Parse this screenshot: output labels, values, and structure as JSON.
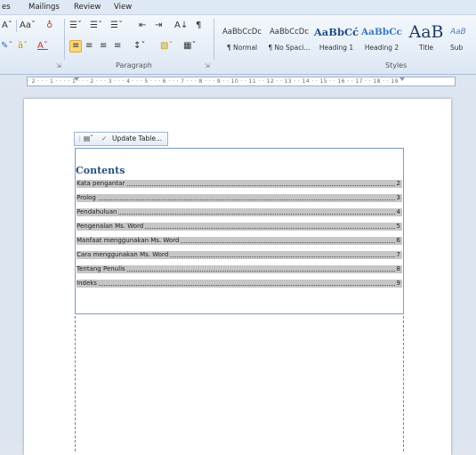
{
  "menu": {
    "tabs": [
      "es",
      "Mailings",
      "Review",
      "View"
    ]
  },
  "ribbon": {
    "font_row1": [
      "Aˆ",
      "Aaˇ",
      "♁"
    ],
    "font_row2": [
      "✎ˇ",
      "āˇ",
      "Aˇ"
    ],
    "paragraph_row1": [
      "☰ˇ",
      "☰ˇ",
      "☰ˇ",
      "⇤",
      "⇥",
      "A↓",
      "¶"
    ],
    "paragraph_row2": [
      "≡",
      "≡",
      "≡",
      "≡",
      "↕ˇ",
      "▧ˇ",
      "▦ˇ"
    ],
    "paragraph_label": "Paragraph",
    "styles_label": "Styles",
    "styles": [
      {
        "sample": "AaBbCcDc",
        "name": "¶ Normal"
      },
      {
        "sample": "AaBbCcDc",
        "name": "¶ No Spaci..."
      },
      {
        "sample": "AaBbCć",
        "name": "Heading 1"
      },
      {
        "sample": "AaBbCc",
        "name": "Heading 2"
      },
      {
        "sample": "AaB",
        "name": "Title"
      },
      {
        "sample": "AaB",
        "name": "Sub"
      }
    ]
  },
  "ruler": {
    "marks": "· 2 · · · 1 · · · · 1 · · · 2 · · · 3 · · · 4 · · · 5 · · · 6 · · · 7 · · · 8 · · · 9 · · 10 · · 11 · · 12 · · 13 · · 14 · · 15 · · 16 · · 17 · · 18 · · 19"
  },
  "toc_toolbar": {
    "update_label": "Update Table..."
  },
  "toc": {
    "title": "Contents",
    "entries": [
      {
        "text": "Kata pengantar",
        "page": "2"
      },
      {
        "text": "Prolog",
        "page": "3"
      },
      {
        "text": "Pendahuluan",
        "page": "4"
      },
      {
        "text": "Pengenalan Ms. Word",
        "page": "5"
      },
      {
        "text": "Manfaat menggunakan Ms. Word",
        "page": "6"
      },
      {
        "text": "Cara menggunakan Ms. Word",
        "page": "7"
      },
      {
        "text": "Tentang Penulis",
        "page": "8"
      },
      {
        "text": "Indeks",
        "page": "9"
      }
    ]
  },
  "colors": {
    "toc_heading": "#2a4f7f",
    "field_shading": "#c6c6c6",
    "ribbon_highlight": "#fbd97b"
  }
}
